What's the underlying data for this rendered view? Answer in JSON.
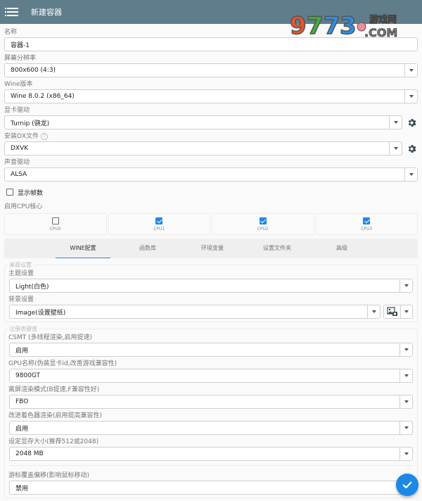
{
  "appbar": {
    "title": "新建容器",
    "menu_icon": "hamburger-menu-icon"
  },
  "watermark": {
    "digits": "9773",
    "site": "游戏网",
    "domain": ".COM"
  },
  "form": {
    "name": {
      "label": "名称",
      "value": "容器-1"
    },
    "resolution": {
      "label": "屏幕分辨率",
      "value": "800x600 (4:3)"
    },
    "wine_version": {
      "label": "Wine版本",
      "value": "Wine 8.0.2 (x86_64)"
    },
    "gpu_driver": {
      "label": "显卡驱动",
      "value": "Turnip (骁龙)",
      "settings_icon": "gear-icon"
    },
    "dx_wrapper": {
      "label": "安装DX文件",
      "help": "?",
      "value": "DXVK",
      "settings_icon": "gear-icon"
    },
    "audio_driver": {
      "label": "声音驱动",
      "value": "ALSA"
    },
    "show_fps": {
      "label": "显示帧数",
      "checked": false
    },
    "cpu_cores": {
      "label": "启用CPU核心",
      "cores": [
        {
          "name": "CPU0",
          "checked": false
        },
        {
          "name": "CPU1",
          "checked": true
        },
        {
          "name": "CPU2",
          "checked": true
        },
        {
          "name": "CPU3",
          "checked": true
        }
      ]
    }
  },
  "tabs": [
    {
      "label": "WINE配置",
      "active": true
    },
    {
      "label": "函数库",
      "active": false
    },
    {
      "label": "环境变量",
      "active": false
    },
    {
      "label": "设置文件夹",
      "active": false
    },
    {
      "label": "高级",
      "active": false
    }
  ],
  "desktop": {
    "legend": "桌面设置",
    "theme": {
      "label": "主题设置",
      "value": "Light(白色)"
    },
    "background": {
      "label": "背景设置",
      "value": "Image(设置壁纸)",
      "picker_icon": "image-picker-icon"
    }
  },
  "registry": {
    "legend": "注册表键值",
    "csmt": {
      "label": "CSMT (多线程渲染,启用提速)",
      "value": "启用"
    },
    "gpu_name": {
      "label": "GPU名称(伪装显卡id,改善游戏兼容性)",
      "value": "9800GT"
    },
    "offscreen": {
      "label": "离屏渲染模式(B提速,F兼容性好)",
      "value": "FBO"
    },
    "glsl": {
      "label": "改进着色器渲染(启用提高兼容性)",
      "value": "启用"
    },
    "vram": {
      "label": "设定显存大小(推荐512或2048)",
      "value": "2048 MB"
    },
    "cursor_warp": {
      "label": "游标覆盖偏移(影响鼠标移动)",
      "value": "禁用"
    }
  },
  "fab": {
    "icon": "checkmark-icon"
  },
  "colors": {
    "appbar": "#607d8b",
    "accent": "#1e88e5",
    "icon_dark": "#37474f"
  }
}
